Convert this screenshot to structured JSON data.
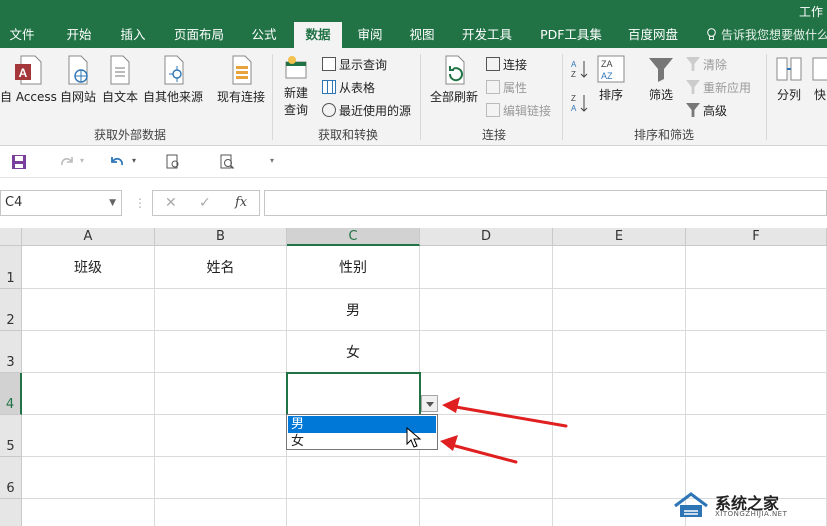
{
  "window": {
    "title": "工作"
  },
  "tabs": [
    "文件",
    "开始",
    "插入",
    "页面布局",
    "公式",
    "数据",
    "审阅",
    "视图",
    "开发工具",
    "PDF工具集",
    "百度网盘"
  ],
  "active_tab": "数据",
  "tell_me": "告诉我您想要做什么",
  "ribbon": {
    "groups": {
      "external": "获取外部数据",
      "transform": "获取和转换",
      "connections": "连接",
      "sort_filter": "排序和筛选"
    },
    "external_buttons": {
      "access": "自 Access",
      "web": "自网站",
      "text": "自文本",
      "other": "自其他来源",
      "existing": "现有连接"
    },
    "transform_buttons": {
      "new_query_1": "新建",
      "new_query_2": "查询",
      "show_queries": "显示查询",
      "from_table": "从表格",
      "recent_sources": "最近使用的源"
    },
    "connection_buttons": {
      "refresh_all": "全部刷新",
      "connections": "连接",
      "properties": "属性",
      "edit_links": "编辑链接"
    },
    "sort_buttons": {
      "sort": "排序",
      "filter": "筛选",
      "clear": "清除",
      "reapply": "重新应用",
      "advanced": "高级",
      "split": "分列",
      "quick": "快"
    }
  },
  "name_box": "C4",
  "fx": "fx",
  "columns": [
    "A",
    "B",
    "C",
    "D",
    "E",
    "F"
  ],
  "rows": [
    "1",
    "2",
    "3",
    "4",
    "5",
    "6"
  ],
  "cells": {
    "A1": "班级",
    "B1": "姓名",
    "C1": "性别",
    "C2": "男",
    "C3": "女"
  },
  "dropdown": {
    "options": [
      "男",
      "女"
    ],
    "highlighted": "男"
  },
  "watermark": {
    "name": "系统之家",
    "url": "XITONGZHIJIA.NET"
  },
  "colors": {
    "excel_green": "#217346",
    "highlight": "#0078d7",
    "annotation_red": "#e02020"
  }
}
